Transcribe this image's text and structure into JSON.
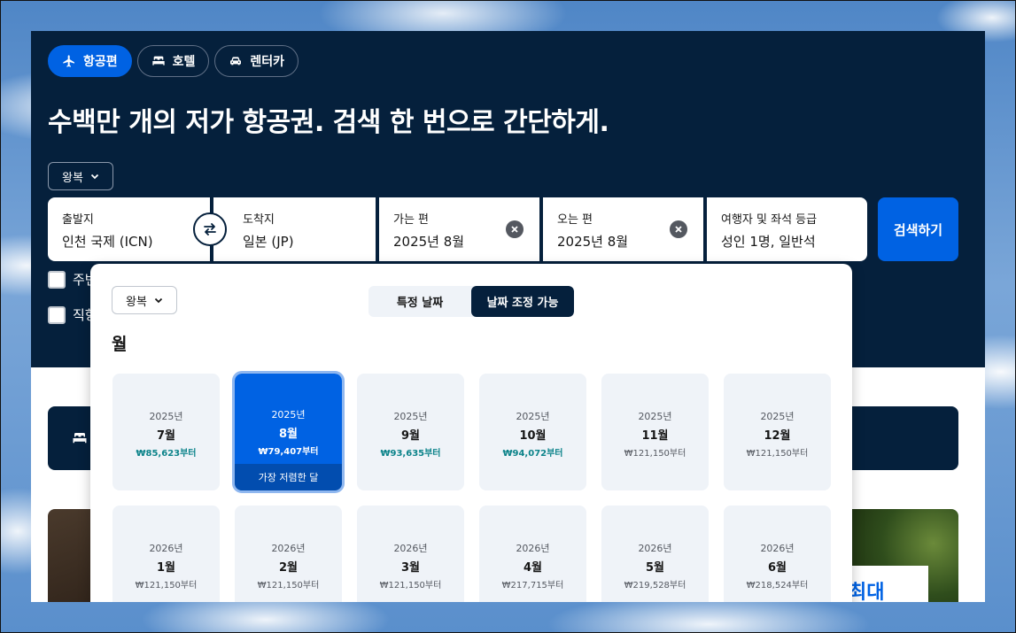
{
  "tabs": [
    {
      "label": "항공편",
      "icon": "plane-icon",
      "active": true
    },
    {
      "label": "호텔",
      "icon": "bed-icon",
      "active": false
    },
    {
      "label": "렌터카",
      "icon": "car-icon",
      "active": false
    }
  ],
  "headline": "수백만 개의 저가 항공권. 검색 한 번으로 간단하게.",
  "trip_type": "왕복",
  "search": {
    "origin": {
      "label": "출발지",
      "value": "인천 국제 (ICN)"
    },
    "destination": {
      "label": "도착지",
      "value": "일본 (JP)"
    },
    "depart": {
      "label": "가는 편",
      "value": "2025년 8월"
    },
    "return": {
      "label": "오는 편",
      "value": "2025년 8월"
    },
    "travellers": {
      "label": "여행자 및 좌석 등급",
      "value": "성인 1명, 일반석"
    },
    "button_label": "검색하기"
  },
  "checkboxes": [
    "주변",
    "직항"
  ],
  "picker": {
    "trip_type": "왕복",
    "segment": [
      {
        "label": "특정 날짜",
        "active": false
      },
      {
        "label": "날짜 조정 가능",
        "active": true
      }
    ],
    "heading": "월",
    "cheapest_label": "가장 저렴한 달",
    "months": [
      {
        "year": "2025년",
        "month": "7월",
        "price": "₩85,623부터",
        "cheap": true,
        "selected": false
      },
      {
        "year": "2025년",
        "month": "8월",
        "price": "₩79,407부터",
        "cheap": true,
        "selected": true
      },
      {
        "year": "2025년",
        "month": "9월",
        "price": "₩93,635부터",
        "cheap": true,
        "selected": false
      },
      {
        "year": "2025년",
        "month": "10월",
        "price": "₩94,072부터",
        "cheap": true,
        "selected": false
      },
      {
        "year": "2025년",
        "month": "11월",
        "price": "₩121,150부터",
        "cheap": false,
        "selected": false
      },
      {
        "year": "2025년",
        "month": "12월",
        "price": "₩121,150부터",
        "cheap": false,
        "selected": false
      },
      {
        "year": "2026년",
        "month": "1월",
        "price": "₩121,150부터",
        "cheap": false,
        "selected": false
      },
      {
        "year": "2026년",
        "month": "2월",
        "price": "₩121,150부터",
        "cheap": false,
        "selected": false
      },
      {
        "year": "2026년",
        "month": "3월",
        "price": "₩121,150부터",
        "cheap": false,
        "selected": false
      },
      {
        "year": "2026년",
        "month": "4월",
        "price": "₩217,715부터",
        "cheap": false,
        "selected": false
      },
      {
        "year": "2026년",
        "month": "5월",
        "price": "₩219,528부터",
        "cheap": false,
        "selected": false
      },
      {
        "year": "2026년",
        "month": "6월",
        "price": "₩218,524부터",
        "cheap": false,
        "selected": false
      }
    ]
  },
  "promo_text": "최대",
  "colors": {
    "hero": "#05203c",
    "accent": "#0062e3",
    "cheap_price": "#0c838a"
  }
}
